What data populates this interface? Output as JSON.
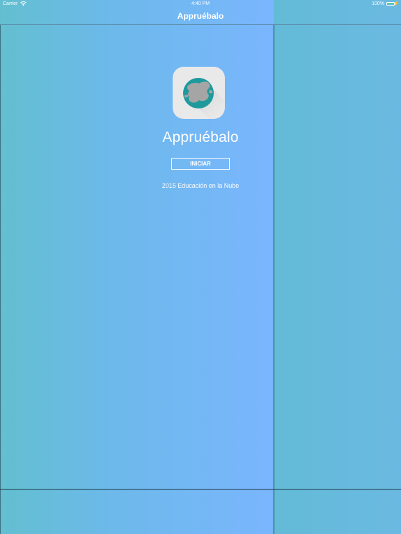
{
  "status_bar": {
    "carrier": "Carrier",
    "time": "4:40 PM",
    "battery": "100%",
    "battery_color": "#4cd964"
  },
  "nav": {
    "title": "Appruébalo"
  },
  "main": {
    "app_icon": "globe-app-icon",
    "app_name": "Appruébalo",
    "start_button": "INICIAR",
    "copyright": "2015 Educación en la Nube"
  },
  "colors": {
    "background_left": "#6cb9ea",
    "background_right": "#67bcd6",
    "globe_teal": "#1f9a9c",
    "globe_gray": "#a5a5a6",
    "icon_bg": "#e9e9ea"
  }
}
